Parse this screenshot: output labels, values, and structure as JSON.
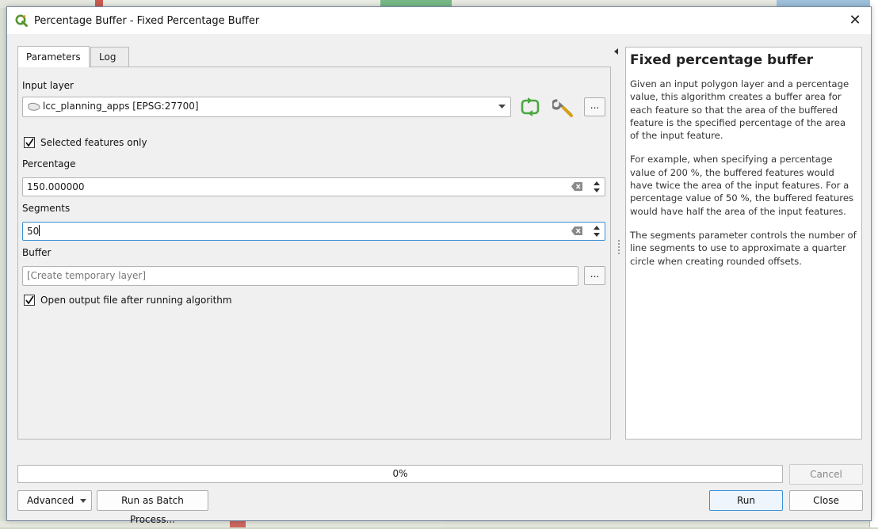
{
  "window": {
    "title": "Percentage Buffer - Fixed Percentage Buffer",
    "close_symbol": "✕"
  },
  "tabs": [
    {
      "label": "Parameters",
      "active": true
    },
    {
      "label": "Log",
      "active": false
    }
  ],
  "params": {
    "input_layer_label": "Input layer",
    "input_layer_value": "lcc_planning_apps [EPSG:27700]",
    "selected_only_label": "Selected features only",
    "selected_only_checked": true,
    "percentage_label": "Percentage",
    "percentage_value": "150.000000",
    "segments_label": "Segments",
    "segments_value": "50",
    "buffer_label": "Buffer",
    "buffer_placeholder": "[Create temporary layer]",
    "open_output_label": "Open output file after running algorithm",
    "open_output_checked": true,
    "browse_label": "..."
  },
  "help": {
    "title": "Fixed percentage buffer",
    "paragraphs": [
      "Given an input polygon layer and a percentage value, this algorithm creates a buffer area for each feature so that the area of the buffered feature is the specified percentage of the area of the input feature.",
      "For example, when specifying a percentage value of 200 %, the buffered features would have twice the area of the input features. For a percentage value of 50 %, the buffered features would have half the area of the input features.",
      "The segments parameter controls the number of line segments to use to approximate a quarter circle when creating rounded offsets."
    ]
  },
  "progress": {
    "value_text": "0%",
    "value": 0
  },
  "buttons": {
    "cancel": "Cancel",
    "advanced": "Advanced",
    "batch": "Run as Batch Process...",
    "run": "Run",
    "close": "Close"
  },
  "colors": {
    "accent": "#3b8fd8",
    "qgis_green": "#589632",
    "refresh_green": "#4aa843"
  }
}
